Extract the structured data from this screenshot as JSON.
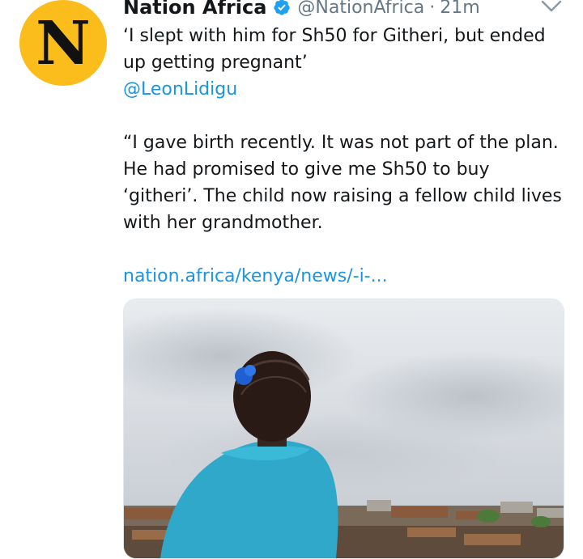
{
  "account": {
    "name": "Nation Africa",
    "handle": "@NationAfrica",
    "separator": "·",
    "time": "21m",
    "avatar_letter": "N",
    "avatar_color": "#fbbd1c",
    "verified_icon": "verified-badge-icon"
  },
  "tweet": {
    "headline": "‘I slept with him for Sh50 for Githeri, but ended up getting pregnant’",
    "mention": "@LeonLidigu",
    "quote": "“I gave birth recently. It was not part of the plan. He had promised to give me Sh50 to buy ‘githeri’. The child now raising a fellow child lives with her grandmother.",
    "link": "nation.africa/kenya/news/-i-..."
  },
  "colors": {
    "link": "#1b95e0",
    "muted": "#657786",
    "text": "#14171a"
  }
}
